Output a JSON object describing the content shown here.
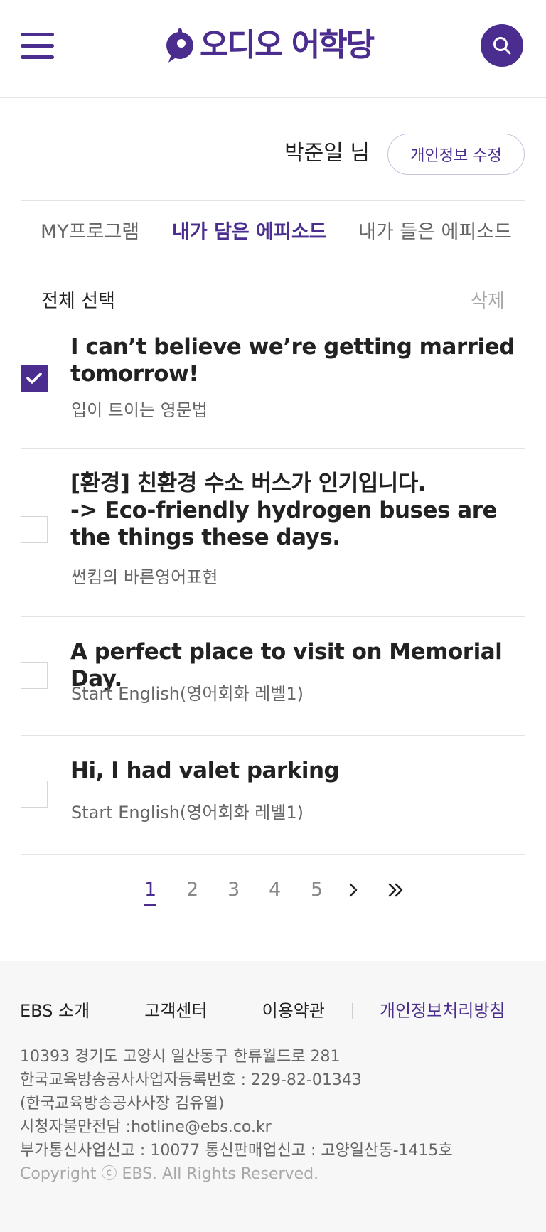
{
  "header": {
    "logo_text": "오디오 어학당",
    "menu_icon": "hamburger-menu-icon",
    "search_icon": "search-icon",
    "brand_color": "#4a2d8f"
  },
  "user": {
    "name": "박준일 님",
    "edit_label": "개인정보 수정"
  },
  "tabs": [
    {
      "label": "MY프로그램",
      "active": false
    },
    {
      "label": "내가 담은 에피소드",
      "active": true
    },
    {
      "label": "내가 들은 에피소드",
      "active": false
    }
  ],
  "list_controls": {
    "select_all": "전체 선택",
    "delete": "삭제"
  },
  "episodes": [
    {
      "title": "I can’t believe we’re getting married tomorrow!",
      "program": "입이 트이는 영문법",
      "checked": true
    },
    {
      "title": "[환경] 친환경 수소 버스가 인기입니다.\n-> Eco-friendly hydrogen buses are the things these days.",
      "program": "썬킴의 바른영어표현",
      "checked": false
    },
    {
      "title": "A perfect place to visit on Memorial Day.",
      "program": "Start English(영어회화 레벨1)",
      "checked": false
    },
    {
      "title": "Hi, I had valet parking",
      "program": "Start English(영어회화 레벨1)",
      "checked": false
    }
  ],
  "pagination": {
    "pages": [
      "1",
      "2",
      "3",
      "4",
      "5"
    ],
    "current": "1",
    "next_icon": "chevron-right-icon",
    "last_icon": "double-chevron-right-icon"
  },
  "footer": {
    "links": [
      "EBS 소개",
      "고객센터",
      "이용약관",
      "개인정보처리방침"
    ],
    "address": "10393 경기도 고양시 일산동구 한류월드로 281",
    "biz_no": "한국교육방송공사사업자등록번호 : 229-82-01343",
    "ceo": "(한국교육방송공사사장 김유열)",
    "hotline": "시청자불만전담 :hotline@ebs.co.kr",
    "telecom": "부가통신사업신고 : 10077 통신판매업신고 : 고양일산동-1415호",
    "copyright": "Copyright ⓒ EBS. All Rights Reserved."
  }
}
